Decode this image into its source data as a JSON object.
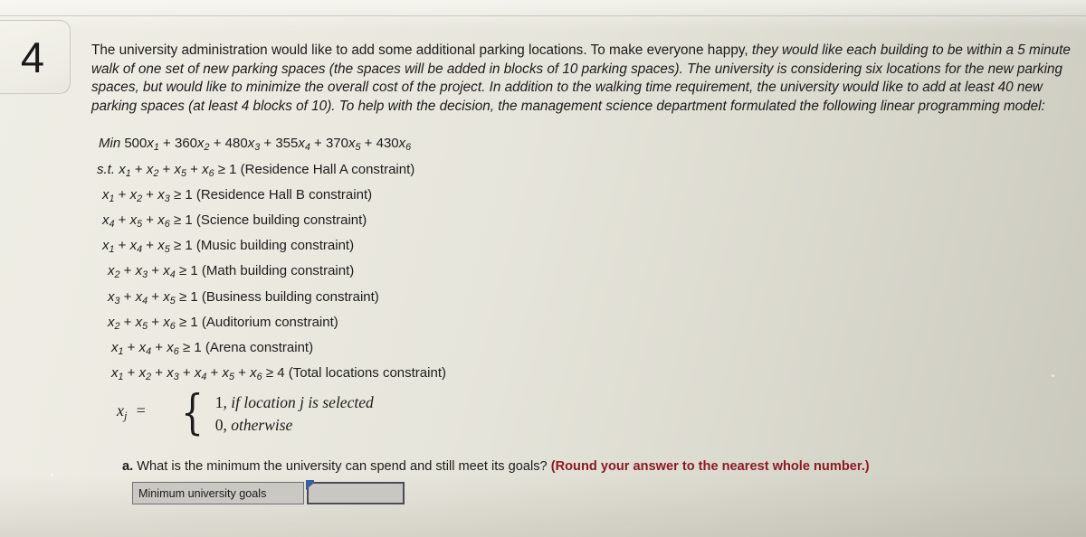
{
  "question_number": "4",
  "intro": {
    "part1_roman": "The university administration would like to add some additional parking locations. To make everyone happy, ",
    "part2_italic": "they would like each building to be within a 5 minute walk of one set of new parking spaces (the spaces will be added in blocks of 10 parking spaces). The university is considering six locations for the new parking spaces, but would like to minimize the overall cost of the project. In addition to the walking time requirement, the university would like to add at least 40 new parking spaces (at least 4 blocks of 10). To help with the decision, the management science department formulated the following linear programming model:"
  },
  "model": {
    "objective": {
      "keyword": "Min",
      "terms": [
        {
          "coef": "500",
          "var": "x",
          "sub": "1"
        },
        {
          "coef": "360",
          "var": "x",
          "sub": "2"
        },
        {
          "coef": "480",
          "var": "x",
          "sub": "3"
        },
        {
          "coef": "355",
          "var": "x",
          "sub": "4"
        },
        {
          "coef": "370",
          "var": "x",
          "sub": "5"
        },
        {
          "coef": "430",
          "var": "x",
          "sub": "6"
        }
      ]
    },
    "constraints": [
      {
        "prefix": "s.t.",
        "vars": [
          "1",
          "2",
          "5",
          "6"
        ],
        "relation": "≥",
        "rhs": "1",
        "label": "(Residence Hall A constraint)"
      },
      {
        "prefix": "",
        "vars": [
          "1",
          "2",
          "3"
        ],
        "relation": "≥",
        "rhs": "1",
        "label": "(Residence Hall B constraint)"
      },
      {
        "prefix": "",
        "vars": [
          "4",
          "5",
          "6"
        ],
        "relation": "≥",
        "rhs": "1",
        "label": "(Science building constraint)"
      },
      {
        "prefix": "",
        "vars": [
          "1",
          "4",
          "5"
        ],
        "relation": "≥",
        "rhs": "1",
        "label": "(Music building constraint)"
      },
      {
        "prefix": "",
        "vars": [
          "2",
          "3",
          "4"
        ],
        "relation": "≥",
        "rhs": "1",
        "label": "(Math building constraint)"
      },
      {
        "prefix": "",
        "vars": [
          "3",
          "4",
          "5"
        ],
        "relation": "≥",
        "rhs": "1",
        "label": "(Business building constraint)"
      },
      {
        "prefix": "",
        "vars": [
          "2",
          "5",
          "6"
        ],
        "relation": "≥",
        "rhs": "1",
        "label": "(Auditorium constraint)"
      },
      {
        "prefix": "",
        "vars": [
          "1",
          "4",
          "6"
        ],
        "relation": "≥",
        "rhs": "1",
        "label": "(Arena constraint)"
      },
      {
        "prefix": "",
        "vars": [
          "1",
          "2",
          "3",
          "4",
          "5",
          "6"
        ],
        "relation": "≥",
        "rhs": "4",
        "label": "(Total locations constraint)"
      }
    ],
    "binary_definition": {
      "lhs": "x",
      "lhs_sub": "j",
      "equals": "=",
      "case_one_number": "1,",
      "case_one_text": "if location j is selected",
      "case_zero_number": "0,",
      "case_zero_text": "otherwise"
    }
  },
  "part_a": {
    "label": "a.",
    "question": "What is the minimum the university can spend and still meet its goals?",
    "note": "(Round your answer to the nearest whole number.)"
  },
  "answer": {
    "field_label": "Minimum university goals",
    "value": "",
    "placeholder": ""
  },
  "colors": {
    "note_red": "#8d1a24",
    "cursor_blue": "#3a5f9e",
    "page_bg": "#e6e5db",
    "input_border": "#4b4b59"
  }
}
